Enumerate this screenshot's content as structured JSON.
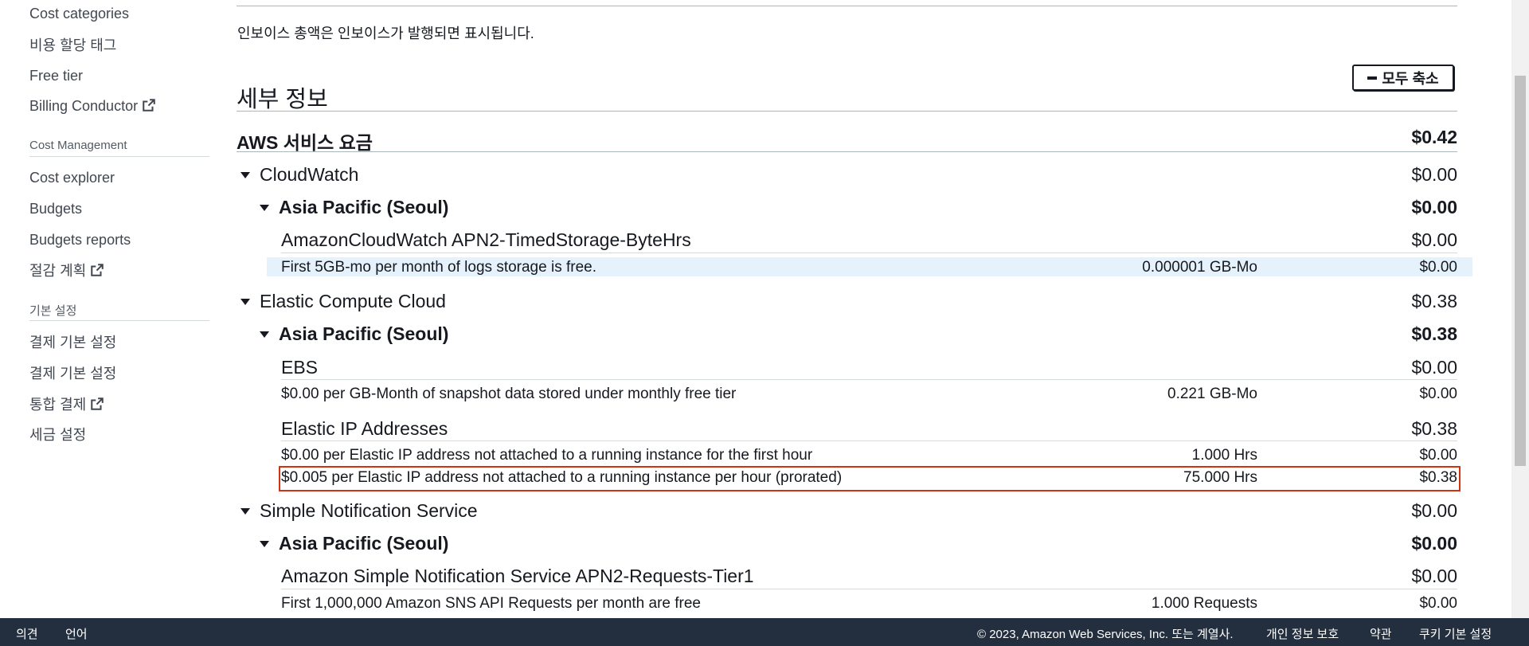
{
  "sidebar": {
    "items_top": [
      {
        "label": "Cost categories"
      },
      {
        "label": "비용 할당 태그"
      },
      {
        "label": "Free tier"
      },
      {
        "label": "Billing Conductor",
        "external": true
      }
    ],
    "cost_management": {
      "header": "Cost Management",
      "items": [
        {
          "label": "Cost explorer"
        },
        {
          "label": "Budgets"
        },
        {
          "label": "Budgets reports"
        },
        {
          "label": "절감 계획",
          "external": true
        }
      ]
    },
    "preferences": {
      "header": "기본 설정",
      "items": [
        {
          "label": "결제 기본 설정"
        },
        {
          "label": "결제 기본 설정"
        },
        {
          "label": "통합 결제",
          "external": true
        },
        {
          "label": "세금 설정"
        }
      ]
    }
  },
  "main": {
    "invoice_note": "인보이스 총액은 인보이스가 발행되면 표시됩니다.",
    "collapse_all_label": "모두 축소",
    "details_title": "세부 정보",
    "aws_charges": {
      "label": "AWS 서비스 요금",
      "total": "$0.42"
    },
    "services": [
      {
        "name": "CloudWatch",
        "amount": "$0.00",
        "region": {
          "name": "Asia Pacific (Seoul)",
          "amount": "$0.00"
        },
        "usage_types": [
          {
            "name": "AmazonCloudWatch APN2-TimedStorage-ByteHrs",
            "amount": "$0.00",
            "lines": [
              {
                "description": "First 5GB-mo per month of logs storage is free.",
                "usage": "0.000001 GB-Mo",
                "amount": "$0.00",
                "highlighted": true
              }
            ]
          }
        ]
      },
      {
        "name": "Elastic Compute Cloud",
        "amount": "$0.38",
        "region": {
          "name": "Asia Pacific (Seoul)",
          "amount": "$0.38"
        },
        "usage_types": [
          {
            "name": "EBS",
            "amount": "$0.00",
            "lines": [
              {
                "description": "$0.00 per GB-Month of snapshot data stored under monthly free tier",
                "usage": "0.221 GB-Mo",
                "amount": "$0.00"
              }
            ]
          },
          {
            "name": "Elastic IP Addresses",
            "amount": "$0.38",
            "lines": [
              {
                "description": "$0.00 per Elastic IP address not attached to a running instance for the first hour",
                "usage": "1.000 Hrs",
                "amount": "$0.00"
              },
              {
                "description": "$0.005 per Elastic IP address not attached to a running instance per hour (prorated)",
                "usage": "75.000 Hrs",
                "amount": "$0.38",
                "outlined": true
              }
            ]
          }
        ]
      },
      {
        "name": "Simple Notification Service",
        "amount": "$0.00",
        "region": {
          "name": "Asia Pacific (Seoul)",
          "amount": "$0.00"
        },
        "usage_types": [
          {
            "name": "Amazon Simple Notification Service APN2-Requests-Tier1",
            "amount": "$0.00",
            "lines": [
              {
                "description": "First 1,000,000 Amazon SNS API Requests per month are free",
                "usage": "1.000 Requests",
                "amount": "$0.00"
              }
            ]
          }
        ]
      }
    ]
  },
  "footer": {
    "feedback": "의견",
    "language": "언어",
    "copyright": "© 2023, Amazon Web Services, Inc. 또는 계열사.",
    "privacy": "개인 정보 보호",
    "terms": "약관",
    "cookie_prefs": "쿠키 기본 설정"
  }
}
